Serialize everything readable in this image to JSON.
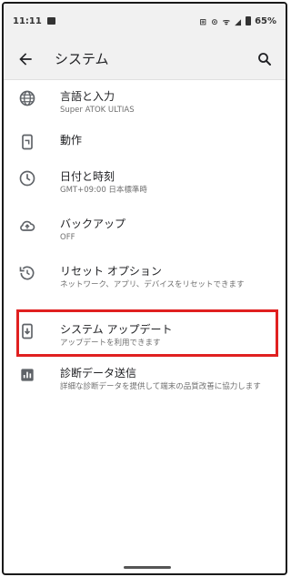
{
  "status_bar": {
    "time": "11:11",
    "icons": "⊞ ⊙ ᯤ ◢",
    "battery": "65%"
  },
  "app_bar": {
    "title": "システム"
  },
  "settings": [
    {
      "title": "言語と入力",
      "subtitle": "Super ATOK ULTIAS",
      "icon": "globe-icon"
    },
    {
      "title": "動作",
      "subtitle": "",
      "icon": "gesture-phone-icon"
    },
    {
      "title": "日付と時刻",
      "subtitle": "GMT+09:00 日本標準時",
      "icon": "clock-icon"
    },
    {
      "title": "バックアップ",
      "subtitle": "OFF",
      "icon": "cloud-upload-icon"
    },
    {
      "title": "リセット オプション",
      "subtitle": "ネットワーク、アプリ、デバイスをリセットできます",
      "icon": "history-icon"
    },
    {
      "title": "システム アップデート",
      "subtitle": "アップデートを利用できます",
      "icon": "system-update-icon"
    },
    {
      "title": "診断データ送信",
      "subtitle": "詳細な診断データを提供して端末の品質改善に協力します",
      "icon": "chart-icon"
    }
  ],
  "highlight_color": "#e02020"
}
